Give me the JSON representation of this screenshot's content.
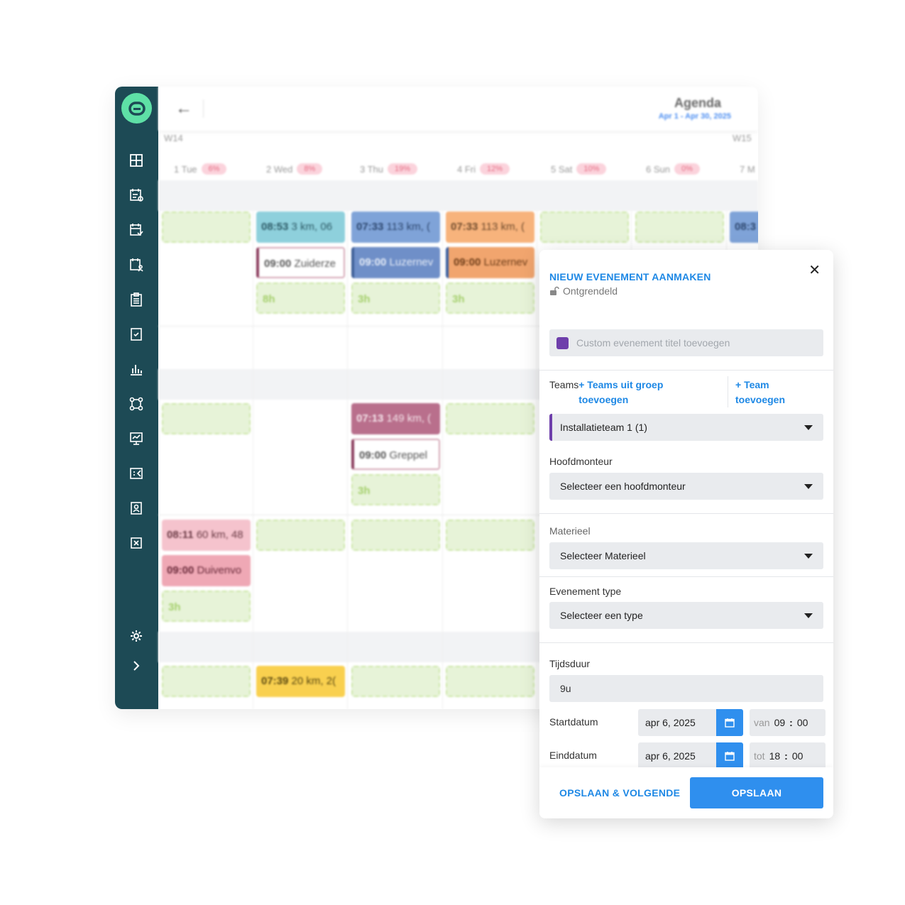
{
  "agenda": {
    "title": "Agenda",
    "range": "Apr 1 - Apr 30, 2025",
    "weeks": [
      "W14",
      "W15"
    ],
    "days": [
      {
        "label": "1 Tue",
        "pct": "6%"
      },
      {
        "label": "2 Wed",
        "pct": "8%"
      },
      {
        "label": "3 Thu",
        "pct": "19%"
      },
      {
        "label": "4 Fri",
        "pct": "12%"
      },
      {
        "label": "5 Sat",
        "pct": "10%"
      },
      {
        "label": "6 Sun",
        "pct": "0%"
      },
      {
        "label": "7 M",
        "pct": ""
      }
    ],
    "events": {
      "e1": {
        "time": "08:53",
        "text": "3 km, 06"
      },
      "e2": {
        "time": "07:33",
        "text": "113 km, ("
      },
      "e3": {
        "time": "07:33",
        "text": "113 km, ("
      },
      "e4": {
        "time": "08:3",
        "text": ""
      },
      "e5": {
        "time": "09:00",
        "text": "Zuiderze"
      },
      "e6": {
        "time": "09:00",
        "text": "Luzernev"
      },
      "e7": {
        "time": "09:00",
        "text": "Luzernev"
      },
      "e8": {
        "time": "07:13",
        "text": "149 km, ("
      },
      "e9": {
        "time": "09:00",
        "text": "Greppel"
      },
      "e10": {
        "time": "08:11",
        "text": "60 km, 48"
      },
      "e11": {
        "time": "09:00",
        "text": "Duivenvo"
      },
      "e12": {
        "time": "07:39",
        "text": "20 km, 2("
      },
      "h8": "8h",
      "h3": "3h"
    }
  },
  "modal": {
    "title": "NIEUW EVENEMENT AANMAKEN",
    "lock_status": "Ontgrendeld",
    "title_placeholder": "Custom evenement titel toevoegen",
    "teams_label": "Teams",
    "teams_group_link": "+ Teams uit groep toevoegen",
    "team_add_link_1": "+ Team",
    "team_add_link_2": "toevoegen",
    "team_selected": "Installatieteam 1 (1)",
    "hoofdmonteur_label": "Hoofdmonteur",
    "hoofdmonteur_value": "Selecteer een hoofdmonteur",
    "materieel_label": "Materieel",
    "materieel_value": "Selecteer Materieel",
    "type_label": "Evenement type",
    "type_value": "Selecteer een type",
    "duration_label": "Tijdsduur",
    "duration_value": "9u",
    "start_label": "Startdatum",
    "start_date": "apr 6, 2025",
    "start_prefix": "van",
    "start_hour": "09",
    "start_min": "00",
    "end_label": "Einddatum",
    "end_date": "apr 6, 2025",
    "end_prefix": "tot",
    "end_hour": "18",
    "end_min": "00",
    "save_next": "OPSLAAN & VOLGENDE",
    "save": "OPSLAAN"
  },
  "colors": {
    "sidebar": "#1d4a55",
    "logo": "#5ee0a6",
    "accent": "#2f8fee",
    "team_marker": "#6e3fab"
  }
}
